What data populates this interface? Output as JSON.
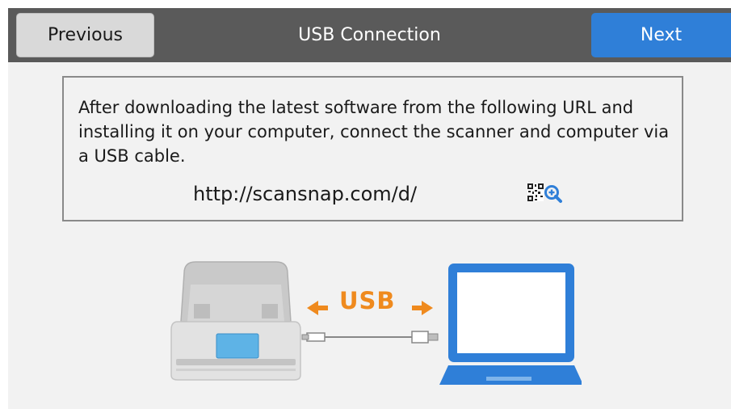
{
  "header": {
    "title": "USB Connection",
    "previous_label": "Previous",
    "next_label": "Next"
  },
  "info": {
    "text": "After downloading the latest software from the following URL and installing it on your computer, connect the scanner and computer via a USB cable.",
    "url": "http://scansnap.com/d/"
  },
  "illustration": {
    "usb_label": "USB"
  },
  "icons": {
    "qr_zoom": "qr-code-zoom-icon",
    "scanner": "scanner-icon",
    "laptop": "laptop-icon",
    "left_arrow": "arrow-left-icon",
    "right_arrow": "arrow-right-icon"
  },
  "colors": {
    "header_bg": "#5a5a5a",
    "next_button": "#2f7fd8",
    "usb_orange": "#ef8a1e",
    "laptop_blue": "#2f7fd8",
    "screen_bg": "#f2f2f2"
  }
}
